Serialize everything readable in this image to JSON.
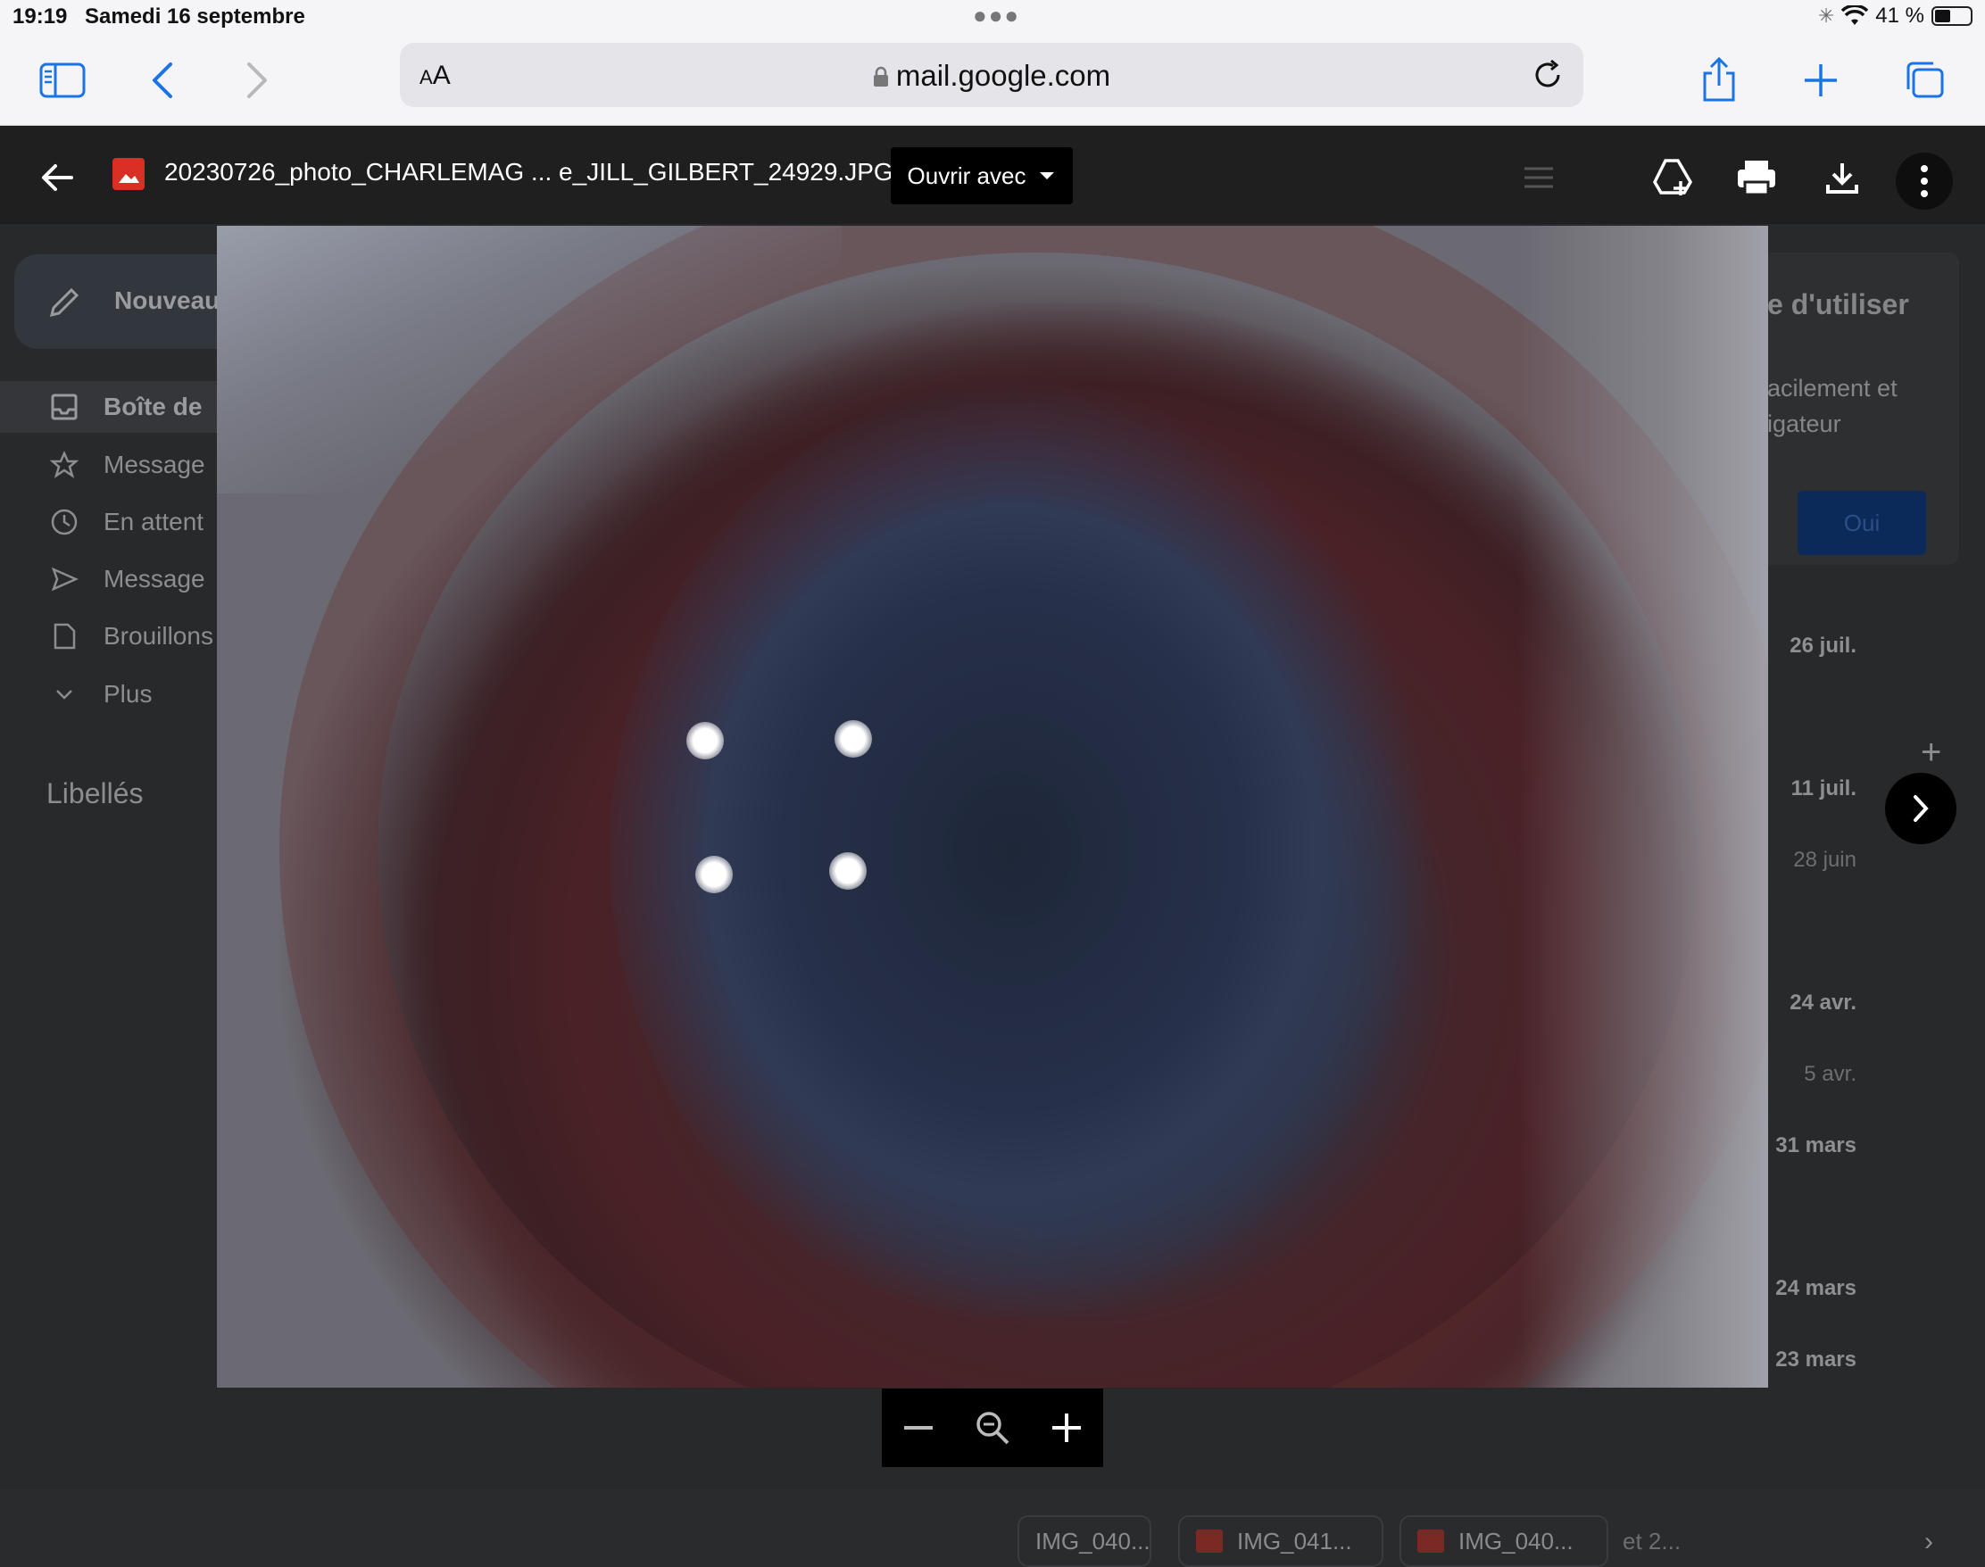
{
  "status_bar": {
    "time": "19:19",
    "date": "Samedi 16 septembre",
    "battery": "41 %",
    "battery_level": 0.41
  },
  "safari": {
    "aa_small": "A",
    "aa_large": "A",
    "url": "mail.google.com"
  },
  "gmail_bg": {
    "compose_label": "Nouveau",
    "nav": [
      {
        "label": "Boîte de",
        "icon": "inbox-icon"
      },
      {
        "label": "Message",
        "icon": "star-icon"
      },
      {
        "label": "En attent",
        "icon": "clock-icon"
      },
      {
        "label": "Message",
        "icon": "send-icon"
      },
      {
        "label": "Brouillons",
        "icon": "draft-icon"
      },
      {
        "label": "Plus",
        "icon": "chevron-down-icon"
      }
    ],
    "labels_heading": "Libellés",
    "promo": {
      "heading": "e d'utiliser",
      "line1": "acilement et",
      "line2": "igateur",
      "button": "Oui"
    },
    "dates": [
      "26 juil.",
      "11 juil.",
      "28 juin",
      "24 avr.",
      "5 avr.",
      "31 mars",
      "24 mars",
      "23 mars"
    ],
    "attachments": [
      "IMG_040...",
      "IMG_041...",
      "IMG_040..."
    ],
    "more_attachments": "et 2..."
  },
  "viewer": {
    "filename": "20230726_photo_CHARLEMAG ... e_JILL_GILBERT_24929.JPG",
    "open_with": "Ouvrir avec"
  },
  "colors": {
    "viewer_bar": "#1f1f20",
    "file_icon_red": "#d93025",
    "safari_blue": "#1a73e8"
  }
}
